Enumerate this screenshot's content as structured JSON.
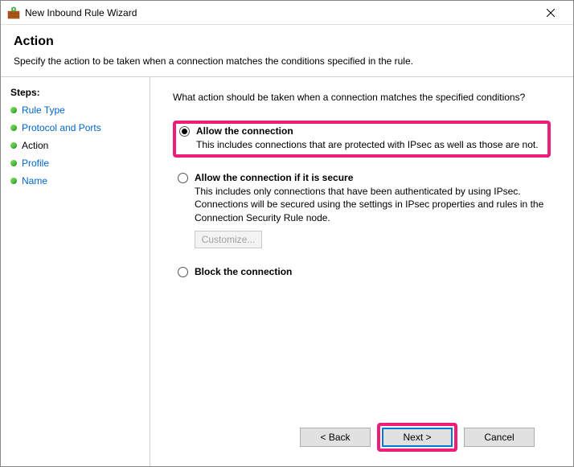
{
  "window": {
    "title": "New Inbound Rule Wizard"
  },
  "header": {
    "title": "Action",
    "subtitle": "Specify the action to be taken when a connection matches the conditions specified in the rule."
  },
  "sidebar": {
    "label": "Steps:",
    "items": [
      {
        "label": "Rule Type",
        "current": false
      },
      {
        "label": "Protocol and Ports",
        "current": false
      },
      {
        "label": "Action",
        "current": true
      },
      {
        "label": "Profile",
        "current": false
      },
      {
        "label": "Name",
        "current": false
      }
    ]
  },
  "content": {
    "prompt": "What action should be taken when a connection matches the specified conditions?",
    "options": {
      "allow": {
        "title": "Allow the connection",
        "desc": "This includes connections that are protected with IPsec as well as those are not."
      },
      "allow_secure": {
        "title": "Allow the connection if it is secure",
        "desc": "This includes only connections that have been authenticated by using IPsec. Connections will be secured using the settings in IPsec properties and rules in the Connection Security Rule node.",
        "customize": "Customize..."
      },
      "block": {
        "title": "Block the connection"
      }
    }
  },
  "footer": {
    "back": "< Back",
    "next": "Next >",
    "cancel": "Cancel"
  }
}
